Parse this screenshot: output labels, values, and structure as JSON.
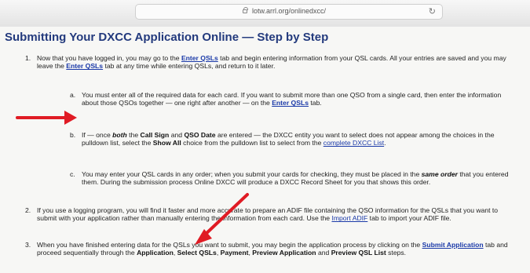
{
  "browser": {
    "url": "lotw.arrl.org/onlinedxcc/"
  },
  "page": {
    "title": "Submitting Your DXCC Application Online — Step by Step"
  },
  "steps": {
    "s1": {
      "num": "1.",
      "a": "Now that you have logged in, you may go to the ",
      "link1": "Enter QSLs",
      "b": " tab and begin entering information from your QSL cards. All your entries are saved and you may leave the ",
      "link2": "Enter QSLs",
      "c": " tab at any time while entering QSLs, and return to it later."
    },
    "sa": {
      "num": "a.",
      "a": "You must enter all of the required data for each card. If you want to submit more than one QSO from a single card, then enter the information about those QSOs together — one right after another — on the ",
      "link": "Enter QSLs",
      "b": " tab."
    },
    "sb": {
      "num": "b.",
      "a": "If — once ",
      "bold1": "both",
      "b": " the ",
      "bold2": "Call Sign",
      "c": " and ",
      "bold3": "QSO Date",
      "d": " are entered — the DXCC entity you want to select does not appear among the choices in the pulldown list, select the ",
      "bold4": "Show All",
      "e": " choice from the pulldown list to select from the ",
      "link": "complete DXCC List",
      "f": "."
    },
    "sc": {
      "num": "c.",
      "a": "You may enter your QSL cards in any order; when you submit your cards for checking, they must be placed in the ",
      "bold": "same order",
      "b": " that you entered them. During the submission process Online DXCC will produce a DXCC Record Sheet for you that shows this order."
    },
    "s2": {
      "num": "2.",
      "a": "If you use a logging program, you will find it faster and more accurate to prepare an ADIF file containing the QSO information for the QSLs that you want to submit with your application rather than manually entering the information from each card. Use the ",
      "link": "Import ADIF",
      "b": " tab to import your ADIF file."
    },
    "s3": {
      "num": "3.",
      "a": "When you have finished entering data for the QSLs you want to submit, you may begin the application process by clicking on the ",
      "link": "Submit Application",
      "b": " tab and proceed sequentially through the ",
      "bold1": "Application",
      "c": ", ",
      "bold2": "Select QSLs",
      "d": ", ",
      "bold3": "Payment",
      "e": ", ",
      "bold4": "Preview Application",
      "f": " and ",
      "bold5": "Preview QSL List",
      "g": " steps."
    }
  },
  "colors": {
    "title": "#233a7d",
    "link": "#1a39a8",
    "arrow": "#e01b24"
  }
}
